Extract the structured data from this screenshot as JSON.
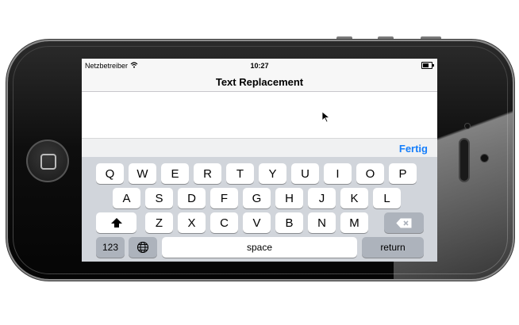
{
  "status_bar": {
    "carrier": "Netzbetreiber",
    "wifi_icon": "wifi-icon",
    "time": "10:27",
    "battery_icon": "battery-icon"
  },
  "nav": {
    "title": "Text Replacement"
  },
  "accessory": {
    "done_label": "Fertig"
  },
  "keyboard": {
    "row1": [
      "Q",
      "W",
      "E",
      "R",
      "T",
      "Y",
      "U",
      "I",
      "O",
      "P"
    ],
    "row2": [
      "A",
      "S",
      "D",
      "F",
      "G",
      "H",
      "J",
      "K",
      "L"
    ],
    "row3": [
      "Z",
      "X",
      "C",
      "V",
      "B",
      "N",
      "M"
    ],
    "shift_icon": "shift-arrow-icon",
    "delete_icon": "backspace-icon",
    "numbers_label": "123",
    "globe_icon": "globe-icon",
    "space_label": "space",
    "return_label": "return"
  },
  "colors": {
    "accent": "#157efb",
    "keyboard_bg": "#d1d5db",
    "dark_key": "#adb3bc"
  }
}
